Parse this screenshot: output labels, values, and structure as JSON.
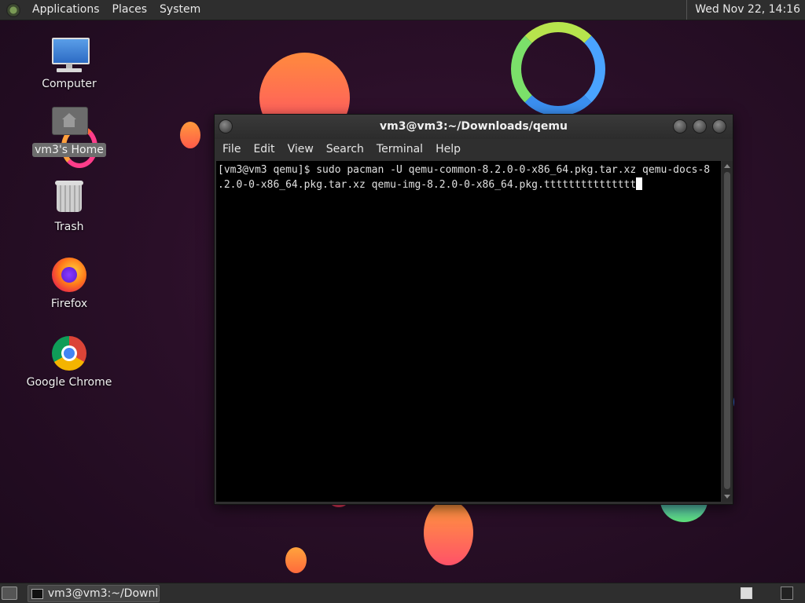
{
  "top_panel": {
    "menus": [
      "Applications",
      "Places",
      "System"
    ],
    "clock": "Wed Nov 22, 14:16"
  },
  "desktop_icons": [
    {
      "label": "Computer",
      "icon": "computer-icon"
    },
    {
      "label": "vm3's Home",
      "icon": "home-folder-icon",
      "selected": true
    },
    {
      "label": "Trash",
      "icon": "trash-icon"
    },
    {
      "label": "Firefox",
      "icon": "firefox-icon"
    },
    {
      "label": "Google Chrome",
      "icon": "chrome-icon"
    }
  ],
  "terminal": {
    "title": "vm3@vm3:~/Downloads/qemu",
    "menu": [
      "File",
      "Edit",
      "View",
      "Search",
      "Terminal",
      "Help"
    ],
    "lines": [
      "[vm3@vm3 qemu]$ sudo pacman -U qemu-common-8.2.0-0-x86_64.pkg.tar.xz qemu-docs-8",
      ".2.0-0-x86_64.pkg.tar.xz qemu-img-8.2.0-0-x86_64.pkg.ttttttttttttttt"
    ]
  },
  "taskbar": {
    "window_button": "vm3@vm3:~/Downl..."
  },
  "colors": {
    "panel": "#2e2e2e",
    "wallpaper": "#2a0f28",
    "terminal_bg": "#000000"
  }
}
